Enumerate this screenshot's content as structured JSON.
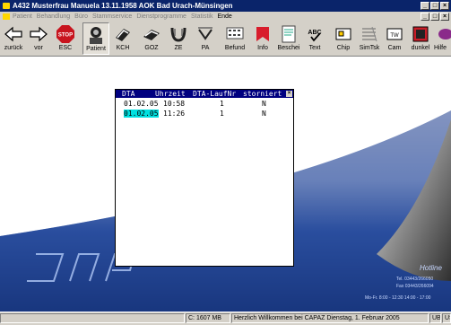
{
  "window": {
    "title": "A432 Musterfrau Manuela 13.11.1958  AOK Bad Urach-Münsingen",
    "buttons": [
      "_",
      "□",
      "×"
    ]
  },
  "menu": {
    "items": [
      {
        "label": "Patient",
        "enabled": false
      },
      {
        "label": "Behandlung",
        "enabled": false
      },
      {
        "label": "Büro",
        "enabled": false
      },
      {
        "label": "Stammservice",
        "enabled": false
      },
      {
        "label": "Dienstprogramme",
        "enabled": false
      },
      {
        "label": "Statistik",
        "enabled": false
      },
      {
        "label": "Ende",
        "enabled": true
      }
    ],
    "buttons": [
      "_",
      "□",
      "×"
    ]
  },
  "toolbar": {
    "items": [
      {
        "label": "zurück",
        "icon": "arrow-left-icon"
      },
      {
        "label": "vor",
        "icon": "arrow-right-icon"
      },
      {
        "label": "ESC",
        "icon": "stop-sign-icon"
      },
      {
        "label": "Patient",
        "icon": "patient-icon",
        "pressed": true
      },
      {
        "label": "KCH",
        "icon": "kch-icon"
      },
      {
        "label": "GOZ",
        "icon": "goz-icon"
      },
      {
        "label": "ZE",
        "icon": "ze-icon"
      },
      {
        "label": "PA",
        "icon": "pa-icon"
      },
      {
        "label": "Befund",
        "icon": "befund-icon"
      },
      {
        "label": "Info",
        "icon": "info-icon"
      },
      {
        "label": "Beschei",
        "icon": "bescheid-icon"
      },
      {
        "label": "Text",
        "icon": "text-icon"
      },
      {
        "label": "Chip",
        "icon": "chip-icon"
      },
      {
        "label": "SimTsk",
        "icon": "simtsk-icon"
      },
      {
        "label": "Cam",
        "icon": "cam-icon"
      },
      {
        "label": "dunkel",
        "icon": "dunkel-icon"
      },
      {
        "label": "Hilfe",
        "icon": "help-icon"
      }
    ]
  },
  "dta": {
    "headers": [
      "DTA",
      "Uhrzeit",
      "DTA-LaufNr",
      "storniert"
    ],
    "close": "×",
    "rows": [
      {
        "date": "01.02.05",
        "time": "10:58",
        "nr": "1",
        "storniert": "N",
        "selected": false
      },
      {
        "date": "01.02.05",
        "time": "11:26",
        "nr": "1",
        "storniert": "N",
        "selected": true
      }
    ]
  },
  "desktop": {
    "hotline": "Hotline",
    "contact": {
      "tel": "Tel.  03443/266050",
      "fax": "Fax  03443/266094",
      "hours": "Mo-Fr. 8:00 - 12:30  14:00 - 17:00"
    }
  },
  "status": {
    "memory": "C: 1607 MB",
    "message": "Herzlich Willkommen bei CAPAZ Dienstag, 1. Februar 2005",
    "mode": "UB",
    "user": "USER1"
  },
  "colors": {
    "titlebar": "#0a246a",
    "dta_header": "#000080",
    "selection": "#00e0e0",
    "desktop_blue": "#1e3c8c"
  }
}
